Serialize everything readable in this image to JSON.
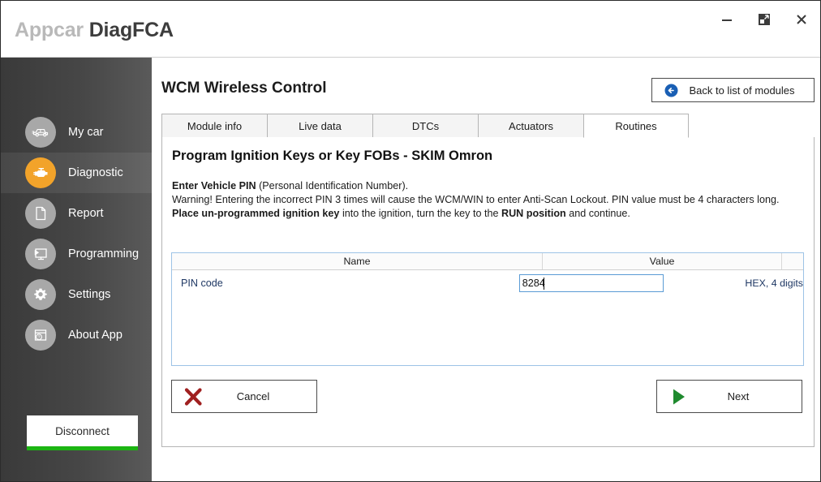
{
  "window": {
    "title_light": "Appcar",
    "title_dark": "DiagFCA",
    "controls": [
      {
        "name": "minimize",
        "label": "–"
      },
      {
        "name": "restore",
        "label": "❐"
      },
      {
        "name": "close",
        "label": "✕"
      }
    ]
  },
  "sidebar": {
    "items": [
      {
        "label": "My car",
        "icon": "car-icon",
        "active": false
      },
      {
        "label": "Diagnostic",
        "icon": "engine-icon",
        "active": true
      },
      {
        "label": "Report",
        "icon": "document-icon",
        "active": false
      },
      {
        "label": "Programming",
        "icon": "monitor-play-icon",
        "active": false
      },
      {
        "label": "Settings",
        "icon": "gear-icon",
        "active": false
      },
      {
        "label": "About App",
        "icon": "help-window-icon",
        "active": false
      }
    ],
    "disconnect_label": "Disconnect",
    "accent_color": "#f2a32a",
    "disconnect_underline_color": "#1cb512"
  },
  "header": {
    "module_title": "WCM Wireless Control",
    "back_button_label": "Back to list of modules",
    "back_icon": "back-circle-icon",
    "back_icon_color": "#1a5fb4"
  },
  "tabs": [
    {
      "label": "Module info",
      "active": false
    },
    {
      "label": "Live data",
      "active": false
    },
    {
      "label": "DTCs",
      "active": false
    },
    {
      "label": "Actuators",
      "active": false
    },
    {
      "label": "Routines",
      "active": true
    }
  ],
  "routine": {
    "title": "Program Ignition Keys or Key FOBs - SKIM Omron",
    "line1_bold": "Enter Vehicle PIN",
    "line1_rest": " (Personal Identification Number).",
    "line2": "Warning! Entering the incorrect PIN 3 times will cause the WCM/WIN to enter Anti-Scan Lockout. PIN value must be 4 characters long.",
    "line3_bold_a": "Place un-programmed ignition key",
    "line3_mid": " into the ignition, turn the key to the ",
    "line3_bold_b": "RUN position",
    "line3_end": " and continue."
  },
  "table": {
    "headers": {
      "name": "Name",
      "value": "Value",
      "unit": ""
    },
    "rows": [
      {
        "name": "PIN code",
        "value": "8284",
        "placeholder": "",
        "unit": "HEX, 4 digits"
      }
    ]
  },
  "actions": {
    "cancel_label": "Cancel",
    "cancel_icon": "red-x-icon",
    "cancel_icon_color": "#a02020",
    "next_label": "Next",
    "next_icon": "green-play-icon",
    "next_icon_color": "#1f8a2e"
  }
}
